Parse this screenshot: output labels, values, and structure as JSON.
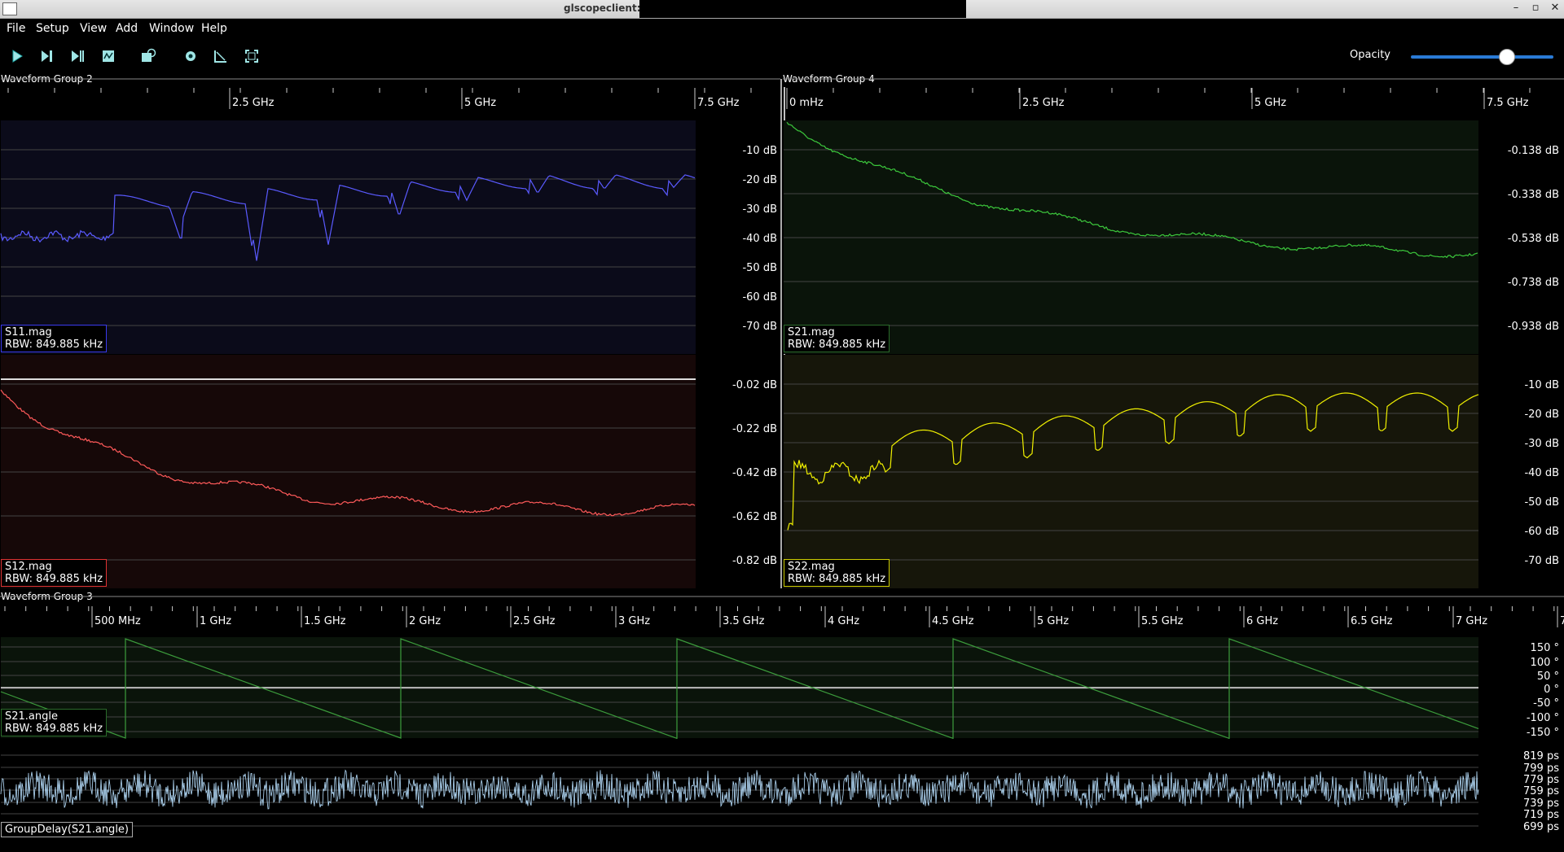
{
  "window": {
    "title": "glscopeclient:",
    "controls": [
      "–",
      "▫",
      "✕"
    ]
  },
  "menu": [
    "File",
    "Setup",
    "View",
    "Add",
    "Window",
    "Help"
  ],
  "toolbar": {
    "buttons": [
      "start-icon",
      "single-trigger-icon",
      "force-trigger-icon",
      "stop-icon",
      "history-icon",
      "settings-icon",
      "measure-icon",
      "fullscreen-icon"
    ],
    "opacity_label": "Opacity",
    "opacity_value": 0.76
  },
  "groups": {
    "g2": {
      "title": "Waveform Group 2",
      "freq_ticks": [
        "2.5 GHz",
        "5 GHz",
        "7.5 GHz"
      ],
      "top": {
        "name": "S11.mag",
        "rbw": "RBW: 849.885 kHz",
        "color": "#5a5aff",
        "ticks": [
          "-10 dB",
          "-20 dB",
          "-30 dB",
          "-40 dB",
          "-50 dB",
          "-60 dB",
          "-70 dB"
        ]
      },
      "bottom": {
        "name": "S12.mag",
        "rbw": "RBW: 849.885 kHz",
        "color": "#ff5a5a",
        "ticks": [
          "-0.02 dB",
          "-0.22 dB",
          "-0.42 dB",
          "-0.62 dB",
          "-0.82 dB"
        ]
      }
    },
    "g4": {
      "title": "Waveform Group 4",
      "freq_ticks": [
        "0 mHz",
        "2.5 GHz",
        "5 GHz",
        "7.5 GHz"
      ],
      "top": {
        "name": "S21.mag",
        "rbw": "RBW: 849.885 kHz",
        "color": "#3cc83c",
        "ticks": [
          "-0.138 dB",
          "-0.338 dB",
          "-0.538 dB",
          "-0.738 dB",
          "-0.938 dB"
        ]
      },
      "bottom": {
        "name": "S22.mag",
        "rbw": "RBW: 849.885 kHz",
        "color": "#f0f000",
        "ticks": [
          "-10 dB",
          "-20 dB",
          "-30 dB",
          "-40 dB",
          "-50 dB",
          "-60 dB",
          "-70 dB"
        ]
      }
    },
    "g3": {
      "title": "Waveform Group 3",
      "freq_ticks": [
        "500 MHz",
        "1 GHz",
        "1.5 GHz",
        "2 GHz",
        "2.5 GHz",
        "3 GHz",
        "3.5 GHz",
        "4 GHz",
        "4.5 GHz",
        "5 GHz",
        "5.5 GHz",
        "6 GHz",
        "6.5 GHz",
        "7 GHz",
        "7"
      ],
      "top": {
        "name": "S21.angle",
        "rbw": "RBW: 849.885 kHz",
        "color": "#3c9c3c",
        "ticks": [
          "150 °",
          "100 °",
          "50 °",
          "0 °",
          "-50 °",
          "-100 °",
          "-150 °"
        ]
      },
      "bottom": {
        "name": "GroupDelay(S21.angle)",
        "color": "#b8e0ff",
        "ticks": [
          "819 ps",
          "799 ps",
          "779 ps",
          "759 ps",
          "739 ps",
          "719 ps",
          "699 ps"
        ]
      }
    }
  }
}
